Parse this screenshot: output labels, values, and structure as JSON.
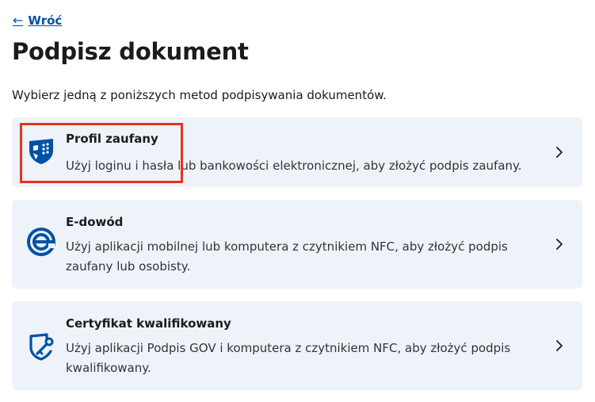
{
  "nav": {
    "back_label": "Wróć",
    "back_icon": "arrow-left-icon"
  },
  "page": {
    "title": "Podpisz dokument",
    "intro": "Wybierz jedną z poniższych metod podpisywania dokumentów."
  },
  "options": [
    {
      "title": "Profil zaufany",
      "description": "Użyj loginu i hasła lub bankowości elektronicznej, aby złożyć podpis zaufany.",
      "icon": "trusted-profile-icon"
    },
    {
      "title": "E-dowód",
      "description": "Użyj aplikacji mobilnej lub komputera z czytnikiem NFC, aby złożyć podpis zaufany lub osobisty.",
      "icon": "e-id-icon"
    },
    {
      "title": "Certyfikat kwalifikowany",
      "description": "Użyj aplikacji Podpis GOV i komputera z czytnikiem NFC, aby złożyć podpis kwalifikowany.",
      "icon": "qualified-certificate-icon"
    }
  ],
  "colors": {
    "link": "#0052a5",
    "card_background": "#eef3fa",
    "icon": "#0052a5",
    "highlight": "#e8321e"
  }
}
